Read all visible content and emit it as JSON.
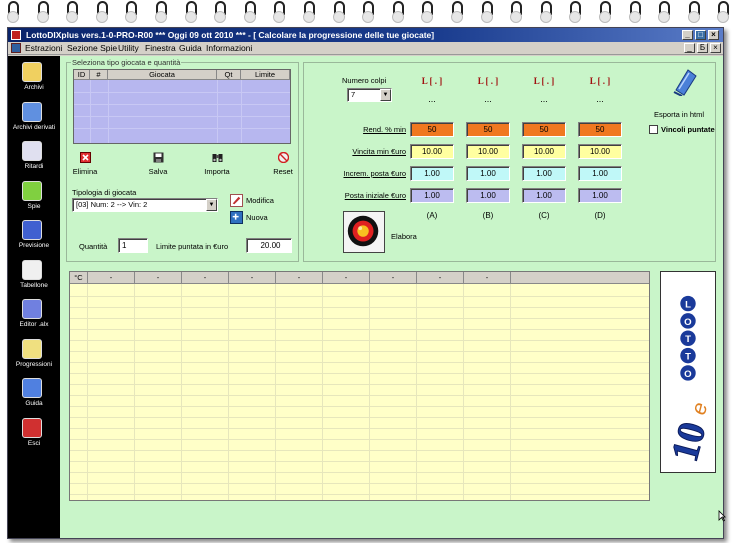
{
  "window": {
    "title": "LottoDIXplus vers.1-0-PRO-R00  ***  Oggi 09 ott 2010  ***   - [ Calcolare la progressione delle tue giocate]",
    "buttons": [
      "_",
      "□",
      "×"
    ]
  },
  "menu": {
    "items": [
      "Estrazioni",
      "Sezione Spie",
      "Utility",
      "Finestra",
      "Guida",
      "Informazioni"
    ],
    "mdi_buttons": [
      "_",
      "Б",
      "×"
    ]
  },
  "sidebar": {
    "items": [
      {
        "label": "Archivi",
        "icon": "pencil-icon",
        "color": "#f0d060"
      },
      {
        "label": "Archivi derivati",
        "icon": "book-icon",
        "color": "#6090e0"
      },
      {
        "label": "Ritardi",
        "icon": "clock-icon",
        "color": "#e0e0f0"
      },
      {
        "label": "Spie",
        "icon": "flashlight-icon",
        "color": "#80d040"
      },
      {
        "label": "Previsione",
        "icon": "chart-icon",
        "color": "#4060d0"
      },
      {
        "label": "Tabellone",
        "icon": "table-icon",
        "color": "#f0f0f0"
      },
      {
        "label": "Editor .alx",
        "icon": "magic-wand-icon",
        "color": "#7080e0"
      },
      {
        "label": "Progressioni",
        "icon": "sun-icon",
        "color": "#f0e080"
      },
      {
        "label": "Guida",
        "icon": "help-book-icon",
        "color": "#5080e0"
      },
      {
        "label": "Esci",
        "icon": "power-icon",
        "color": "#d03030"
      }
    ]
  },
  "selection": {
    "group_title": "Seleziona tipo giocata e quantità",
    "columns": [
      "ID",
      "#",
      "Giocata",
      "Qt",
      "Limite"
    ],
    "actions": [
      {
        "label": "Elimina",
        "icon": "delete-icon",
        "color": "#d02020"
      },
      {
        "label": "Salva",
        "icon": "floppy-disk-icon",
        "color": "#202020"
      },
      {
        "label": "Importa",
        "icon": "binoculars-icon",
        "color": "#202020"
      },
      {
        "label": "Reset",
        "icon": "no-entry-icon",
        "color": "#d02020"
      }
    ],
    "tipologia_label": "Tipologia di giocata",
    "tipologia_value": "[03] Num: 2 --> Vin: 2",
    "modifica_label": "Modifica",
    "nuova_label": "Nuova",
    "quantita_label": "Quantità",
    "quantita_value": "1",
    "limite_label": "Limite puntata in €uro",
    "limite_value": "20.00"
  },
  "progression": {
    "numero_colpi_label": "Numero colpi",
    "numero_colpi_value": "7",
    "col_headers": [
      "L [ . ]",
      "L [ . ]",
      "L [ . ]",
      "L [ . ]"
    ],
    "dots": [
      "...",
      "...",
      "...",
      "..."
    ],
    "rows": [
      {
        "label": "Rend. % min",
        "values": [
          "50",
          "50",
          "50",
          "50"
        ],
        "color": "#f07820"
      },
      {
        "label": "Vincita min €uro",
        "values": [
          "10.00",
          "10.00",
          "10.00",
          "10.00"
        ],
        "color": "#ffffa0"
      },
      {
        "label": "Increm. posta €uro",
        "values": [
          "1.00",
          "1.00",
          "1.00",
          "1.00"
        ],
        "color": "#c0f8f8"
      },
      {
        "label": "Posta iniziale €uro",
        "values": [
          "1.00",
          "1.00",
          "1.00",
          "1.00"
        ],
        "color": "#bcbcf0"
      }
    ],
    "col_labels": [
      "(A)",
      "(B)",
      "(C)",
      "(D)"
    ],
    "esporta_label": "Esporta in html",
    "vincoli_label": "Vincoli puntate",
    "elabora_label": "Elabora"
  },
  "grid": {
    "headers": [
      "°C",
      "-",
      "-",
      "-",
      "-",
      "-",
      "-",
      "-",
      "-",
      "-"
    ]
  },
  "logo": {
    "text": "10 e LOTTO"
  }
}
